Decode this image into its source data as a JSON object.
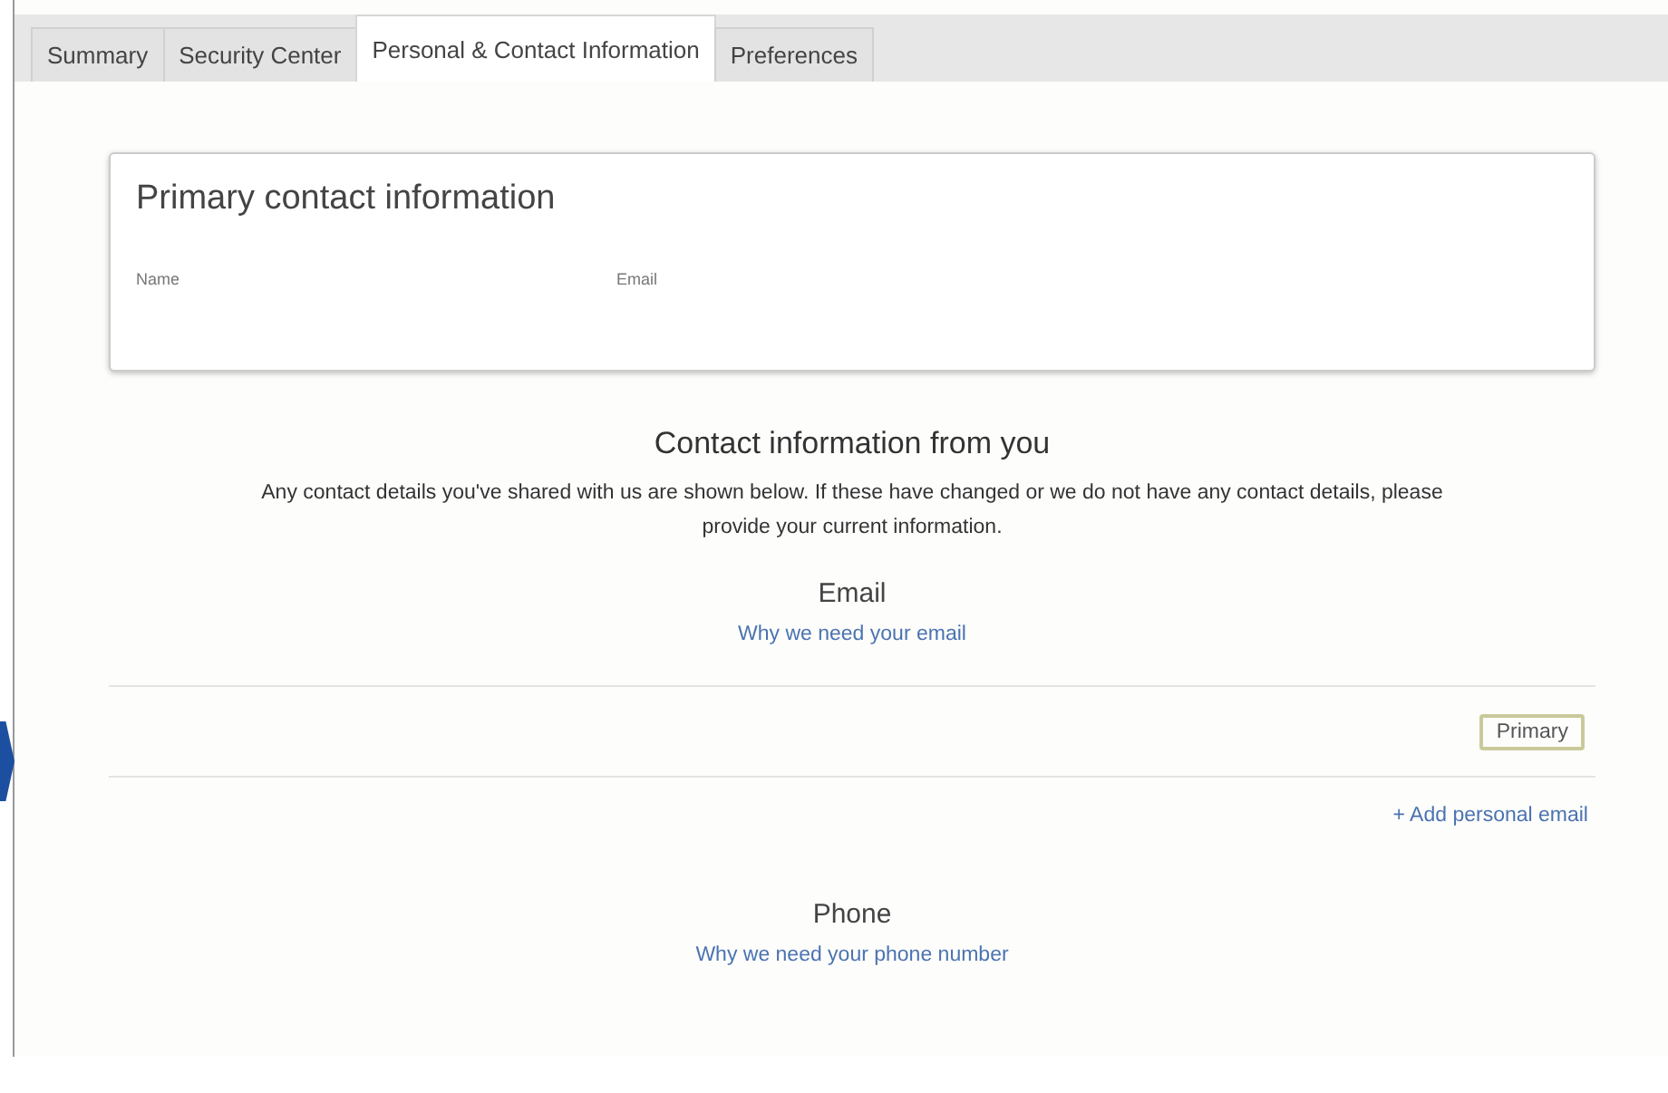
{
  "tabs": [
    {
      "label": "Summary",
      "selected": false
    },
    {
      "label": "Security Center",
      "selected": false
    },
    {
      "label": "Personal & Contact Information",
      "selected": true
    },
    {
      "label": "Preferences",
      "selected": false
    }
  ],
  "primary_card": {
    "title": "Primary contact information",
    "fields": [
      {
        "label": "Name"
      },
      {
        "label": "Email"
      }
    ]
  },
  "contact_section": {
    "title": "Contact information from you",
    "description": "Any contact details you've shared with us are shown below. If these have changed or we do not have any contact details, please provide your current information.",
    "email": {
      "heading": "Email",
      "help_link": "Why we need your email",
      "entries": [
        {
          "badge": "Primary"
        }
      ],
      "add_link": "+ Add personal email"
    },
    "phone": {
      "heading": "Phone",
      "help_link": "Why we need your phone number"
    }
  }
}
